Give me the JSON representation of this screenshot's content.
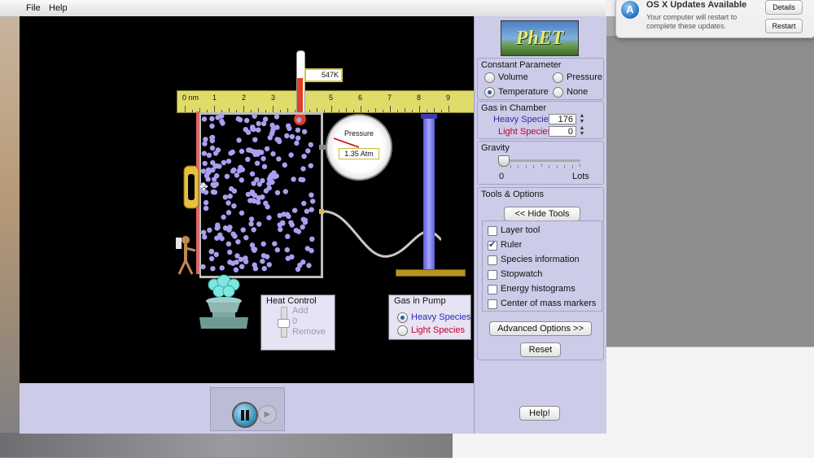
{
  "menu": {
    "file": "File",
    "help": "Help"
  },
  "notification": {
    "title": "OS X Updates Available",
    "body": "Your computer will restart to complete these updates.",
    "details": "Details",
    "restart": "Restart",
    "icon": "app-store-icon"
  },
  "logo": "PhET",
  "constant_parameter": {
    "title": "Constant Parameter",
    "options": [
      "Volume",
      "Pressure",
      "Temperature",
      "None"
    ],
    "selected": "Temperature"
  },
  "gas_in_chamber": {
    "title": "Gas in Chamber",
    "heavy_label": "Heavy Species",
    "heavy_value": "176",
    "light_label": "Light Species",
    "light_value": "0"
  },
  "gravity": {
    "title": "Gravity",
    "min_label": "0",
    "max_label": "Lots",
    "level": 0
  },
  "tools": {
    "title": "Tools & Options",
    "hide_button": "<< Hide Tools",
    "items": [
      {
        "label": "Layer tool",
        "checked": false
      },
      {
        "label": "Ruler",
        "checked": true
      },
      {
        "label": "Species information",
        "checked": false
      },
      {
        "label": "Stopwatch",
        "checked": false
      },
      {
        "label": "Energy histograms",
        "checked": false
      },
      {
        "label": "Center of mass markers",
        "checked": false
      }
    ],
    "advanced_button": "Advanced Options >>",
    "reset_button": "Reset"
  },
  "help_button": "Help!",
  "canvas": {
    "temperature": "547K",
    "pressure_title": "Pressure",
    "pressure_value": "1.35 Atm",
    "ruler_labels": [
      "0 nm",
      "1",
      "2",
      "3",
      "4",
      "5",
      "6",
      "7",
      "8",
      "9"
    ],
    "heat_control": {
      "title": "Heat Control",
      "add": "Add",
      "value": "0",
      "remove": "Remove"
    },
    "gas_in_pump": {
      "title": "Gas in Pump",
      "heavy": "Heavy Species",
      "light": "Light Species",
      "selected": "Heavy Species"
    }
  },
  "colors": {
    "heavy": "#2b2bb0",
    "light": "#c4002a",
    "panel_bg": "#cccbe8",
    "particle": "#a79ff0"
  }
}
